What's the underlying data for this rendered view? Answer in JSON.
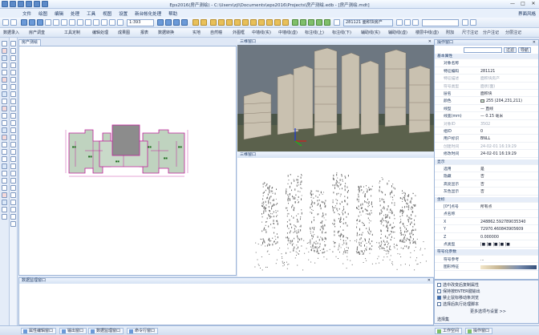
{
  "window": {
    "title": "Eps2016(房产测绘) - C:\\Users\\zjl\\Documents\\eps2016\\Projects\\房产测绘.edb - [房产测绘.mdt]",
    "minimize": "—",
    "maximize": "□",
    "close": "✕"
  },
  "menu": {
    "items": [
      "文件",
      "绘图",
      "编辑",
      "处理",
      "工具",
      "视图",
      "设置",
      "新台帐化处理",
      "帮助"
    ],
    "right": "界面风格"
  },
  "toolbar": {
    "scale": "1:393",
    "layer_code": "281121",
    "layer_name": "面积块房产"
  },
  "toolbar2": {
    "items": [
      "数据录入",
      "房产调査",
      "工具定制",
      "编辑处理",
      "成果图",
      "报表",
      "数据转换",
      "实地",
      "自然幢",
      "外图框",
      "中墙线(实)",
      "中墙线(虚)",
      "标注线(上)",
      "标注线(下)",
      "辅助线(实)",
      "辅助线(虚)",
      "楼层中线(虚)",
      "附加",
      "尺寸注记",
      "分户注记",
      "分层注记"
    ]
  },
  "tabs": {
    "drawing": "房产测绘",
    "view3d": "三维窗口",
    "pointcloud": "三维窗口"
  },
  "properties": {
    "header": "操作窗口",
    "filter_label": "过滤",
    "nav_label": "导航",
    "rows": [
      {
        "type": "section",
        "label": "基本属性"
      },
      {
        "k": "对象名称",
        "v": ""
      },
      {
        "k": "特征编码",
        "v": "281121"
      },
      {
        "k": "特征描述",
        "v": "面积块房产",
        "dim": true
      },
      {
        "k": "符号类型",
        "v": "面状(面)",
        "dim": true
      },
      {
        "k": "层名",
        "v": "面积块"
      },
      {
        "k": "颜色",
        "v": "255 (204,231,211)",
        "swatch": "#cce7d3"
      },
      {
        "k": "线型",
        "v": "— 直线"
      },
      {
        "k": "线宽(mm)",
        "v": "— 0.15 毫米"
      },
      {
        "k": "对象ID",
        "v": "3502",
        "dim": true
      },
      {
        "k": "组ID",
        "v": "0"
      },
      {
        "k": "用户标识",
        "v": "BNLL"
      },
      {
        "k": "创建时间",
        "v": "24-02-01 16:19:29",
        "dim": true
      },
      {
        "k": "修改时间",
        "v": "24-02-01 16:19:29"
      },
      {
        "type": "section",
        "label": "显示"
      },
      {
        "k": "选用",
        "v": "是"
      },
      {
        "k": "隐藏",
        "v": "否"
      },
      {
        "k": "高亮显示",
        "v": "否"
      },
      {
        "k": "灰色显示",
        "v": "否"
      },
      {
        "type": "section",
        "label": "坐标"
      },
      {
        "k": "[0*]点号",
        "v": "所有点"
      },
      {
        "k": "点名称",
        "v": ""
      },
      {
        "k": "X",
        "v": "248862.592789035340"
      },
      {
        "k": "Y",
        "v": "72970.460843905609"
      },
      {
        "k": "Z",
        "v": "0.000000"
      },
      {
        "k": "点类型",
        "v": "|■ |■ |■ |■ |■"
      },
      {
        "type": "section",
        "label": "符号化参数"
      },
      {
        "k": "符号参考",
        "v": "..."
      },
      {
        "k": "图形特征",
        "v": "",
        "bar": true
      }
    ]
  },
  "log": {
    "header": "数据监理窗口"
  },
  "checks": [
    {
      "label": "选中改变后复制属性",
      "on": false
    },
    {
      "label": "保持按ENTER键输出",
      "on": false
    },
    {
      "label": "禁止鼠标移动条浏览",
      "on": true
    },
    {
      "label": "选择后执行处理脚本",
      "on": false
    }
  ],
  "more_settings": "更多选项与设置 >>",
  "select_label": "选择集",
  "statusbar": {
    "tabs": [
      "属性编辑窗口",
      "输出窗口",
      "数据监理窗口",
      "命令行窗口"
    ],
    "right_tabs": [
      "工作空间",
      "操作窗口"
    ]
  }
}
